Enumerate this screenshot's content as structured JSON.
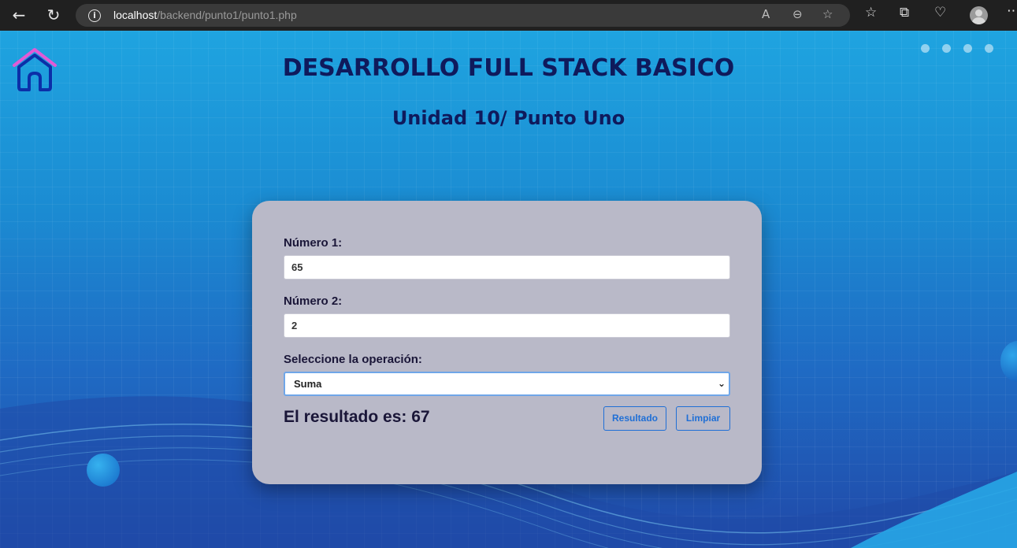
{
  "browser": {
    "url_host": "localhost",
    "url_path": "/backend/punto1/punto1.php"
  },
  "page": {
    "title": "DESARROLLO FULL STACK BASICO",
    "subtitle": "Unidad 10/ Punto Uno"
  },
  "form": {
    "num1_label": "Número 1:",
    "num1_value": "65",
    "num2_label": "Número 2:",
    "num2_value": "2",
    "operation_label": "Seleccione la operación:",
    "operation_selected": "Suma",
    "result_text": "El resultado es: 67",
    "result_button": "Resultado",
    "clear_button": "Limpiar"
  },
  "colors": {
    "title": "#0f1a5c",
    "card": "#b9b9c8",
    "button_accent": "#1f6fd6"
  }
}
